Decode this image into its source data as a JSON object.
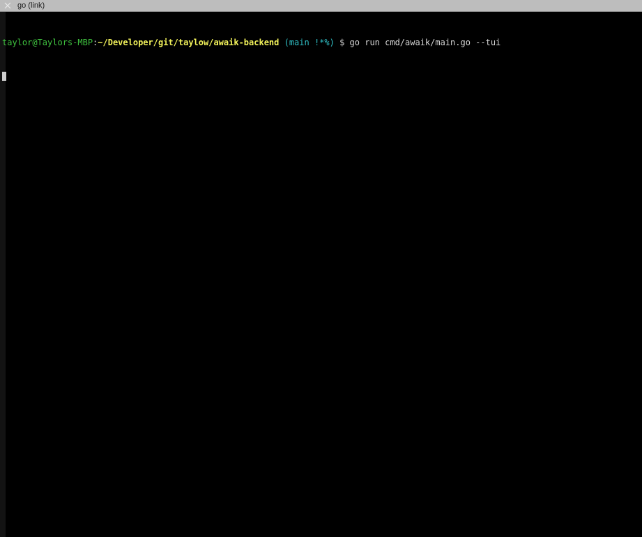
{
  "tab": {
    "title": "go (link)",
    "close_icon": "close-icon"
  },
  "terminal": {
    "prompt": {
      "user_host": "taylor@Taylors-MBP",
      "separator": ":",
      "path": "~/Developer/git/taylow/awaik-backend",
      "branch": " (main !*%)",
      "symbol": " $ "
    },
    "command": "go run cmd/awaik/main.go --tui"
  },
  "colors": {
    "background": "#000000",
    "user_host": "#3fc33f",
    "path": "#f2f25a",
    "branch": "#30c2c8",
    "text": "#d6d6d6"
  }
}
